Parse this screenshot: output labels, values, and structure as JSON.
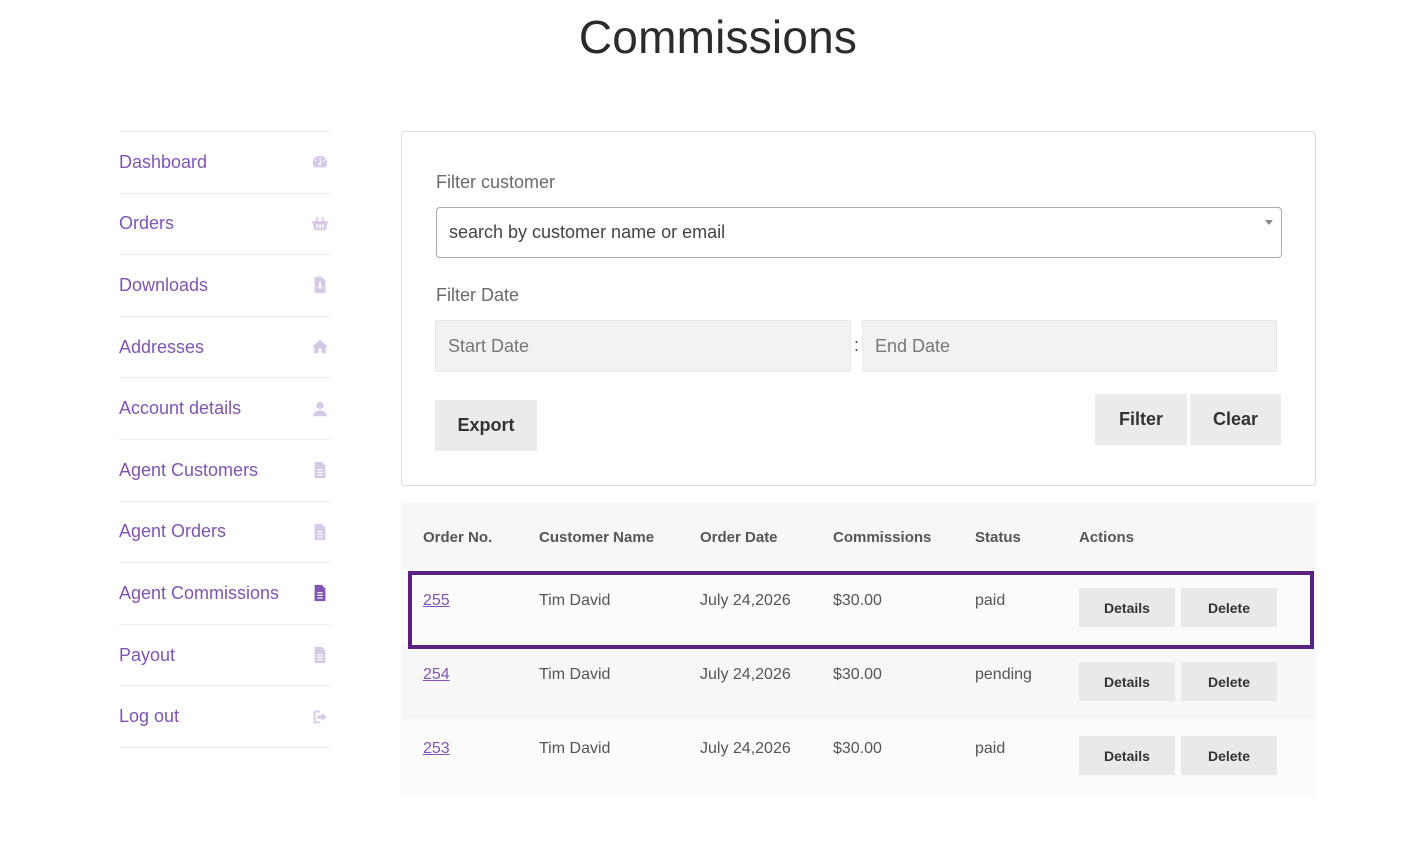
{
  "page": {
    "title": "Commissions"
  },
  "sidebar": {
    "items": [
      {
        "label": "Dashboard",
        "icon": "dashboard-icon"
      },
      {
        "label": "Orders",
        "icon": "basket-icon"
      },
      {
        "label": "Downloads",
        "icon": "file-download-icon"
      },
      {
        "label": "Addresses",
        "icon": "home-icon"
      },
      {
        "label": "Account details",
        "icon": "user-icon"
      },
      {
        "label": "Agent Customers",
        "icon": "document-icon"
      },
      {
        "label": "Agent Orders",
        "icon": "document-icon"
      },
      {
        "label": "Agent Commissions",
        "icon": "document-icon",
        "active": true
      },
      {
        "label": "Payout",
        "icon": "document-icon"
      },
      {
        "label": "Log out",
        "icon": "logout-icon"
      }
    ]
  },
  "filter": {
    "customer_label": "Filter customer",
    "customer_placeholder": "search by customer name or email",
    "date_label": "Filter Date",
    "start_placeholder": "Start Date",
    "separator": ":",
    "end_placeholder": "End Date",
    "export_label": "Export",
    "filter_label": "Filter",
    "clear_label": "Clear"
  },
  "table": {
    "headers": [
      "Order No.",
      "Customer Name",
      "Order Date",
      "Commissions",
      "Status",
      "Actions"
    ],
    "rows": [
      {
        "order": "255",
        "customer": "Tim David",
        "date": "July 24,2026",
        "commission": "$30.00",
        "status": "paid",
        "details": "Details",
        "delete": "Delete"
      },
      {
        "order": "254",
        "customer": "Tim David",
        "date": "July 24,2026",
        "commission": "$30.00",
        "status": "pending",
        "details": "Details",
        "delete": "Delete"
      },
      {
        "order": "253",
        "customer": "Tim David",
        "date": "July 24,2026",
        "commission": "$30.00",
        "status": "paid",
        "details": "Details",
        "delete": "Delete"
      }
    ]
  },
  "colors": {
    "accent": "#7f54b3",
    "highlight": "#5b2181"
  }
}
